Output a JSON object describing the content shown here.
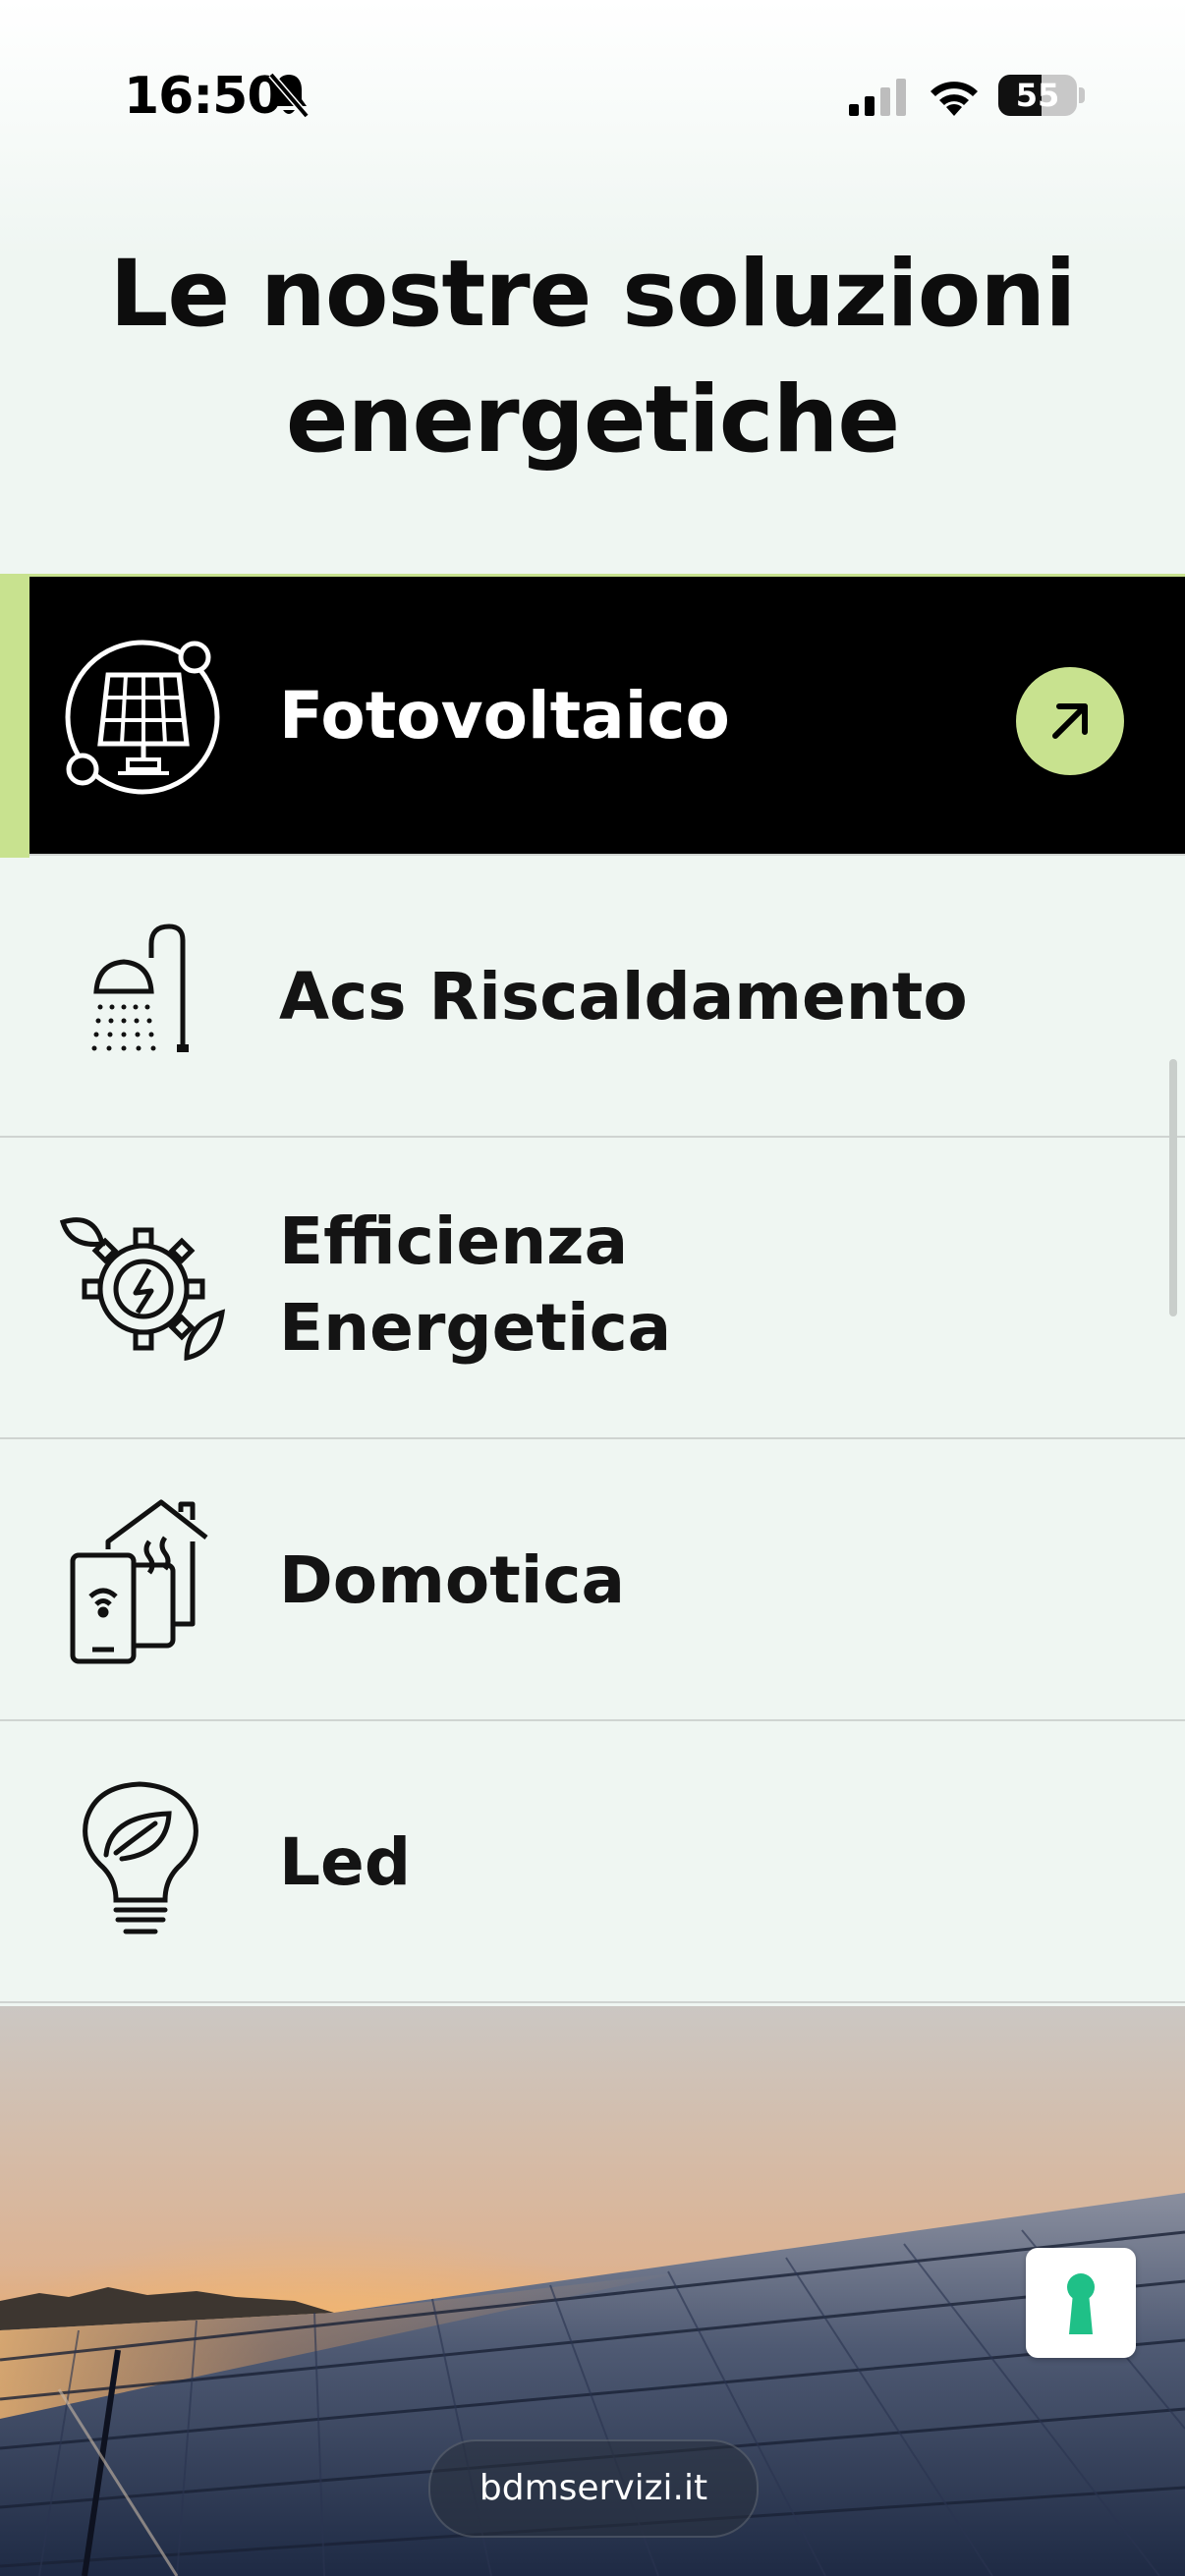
{
  "status_bar": {
    "time": "16:50",
    "battery": "55",
    "battery_level": 0.55
  },
  "page": {
    "title_line1": "Le nostre soluzioni",
    "title_line2": "energetiche"
  },
  "solutions": [
    {
      "label_line1": "Fotovoltaico",
      "label_line2": "",
      "icon": "solar-panel-icon",
      "active": true
    },
    {
      "label_line1": "Acs Riscaldamento",
      "label_line2": "",
      "icon": "shower-icon",
      "active": false
    },
    {
      "label_line1": "Efficienza",
      "label_line2": "Energetica",
      "icon": "energy-gear-icon",
      "active": false
    },
    {
      "label_line1": "Domotica",
      "label_line2": "",
      "icon": "smart-home-icon",
      "active": false
    },
    {
      "label_line1": "Led",
      "label_line2": "",
      "icon": "led-bulb-icon",
      "active": false
    }
  ],
  "colors": {
    "accent": "#c8e28f",
    "background": "#eff6f2",
    "active_background": "#000000"
  },
  "browser": {
    "url": "bdmservizi.it"
  },
  "icons": {
    "arrow": "arrow-up-right-icon",
    "keyhole": "keyhole-icon"
  }
}
